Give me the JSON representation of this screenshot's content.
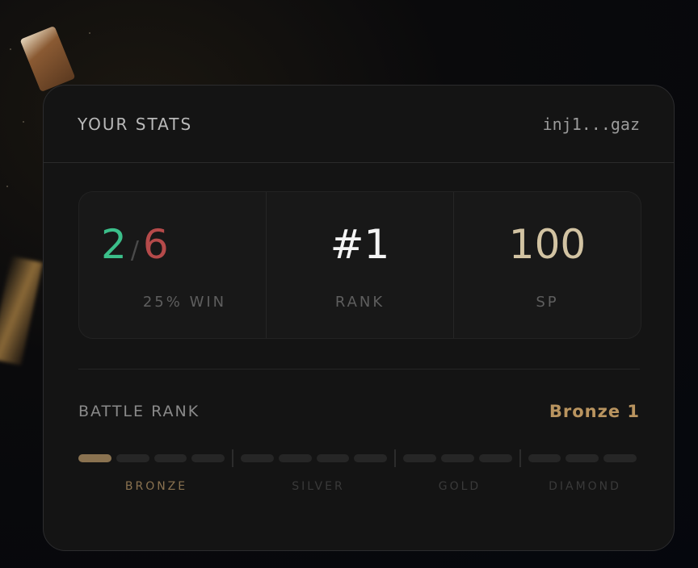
{
  "card": {
    "title": "YOUR STATS",
    "wallet": "inj1...gaz"
  },
  "stats": {
    "wins": "2",
    "separator": "/",
    "losses": "6",
    "win_rate_label": "25% WIN",
    "rank_value": "#1",
    "rank_label": "RANK",
    "sp_value": "100",
    "sp_label": "SP"
  },
  "battle_rank": {
    "label": "BATTLE RANK",
    "value": "Bronze 1",
    "progress_filled_segments": 1,
    "tiers": [
      {
        "name": "BRONZE",
        "segments": 4,
        "active": true
      },
      {
        "name": "SILVER",
        "segments": 4,
        "active": false
      },
      {
        "name": "GOLD",
        "segments": 3,
        "active": false
      },
      {
        "name": "DIAMOND",
        "segments": 3,
        "active": false
      }
    ]
  },
  "colors": {
    "win": "#3bbf8a",
    "loss": "#b54a4a",
    "accent_bronze": "#b9945f",
    "sp": "#d2c3a2"
  }
}
